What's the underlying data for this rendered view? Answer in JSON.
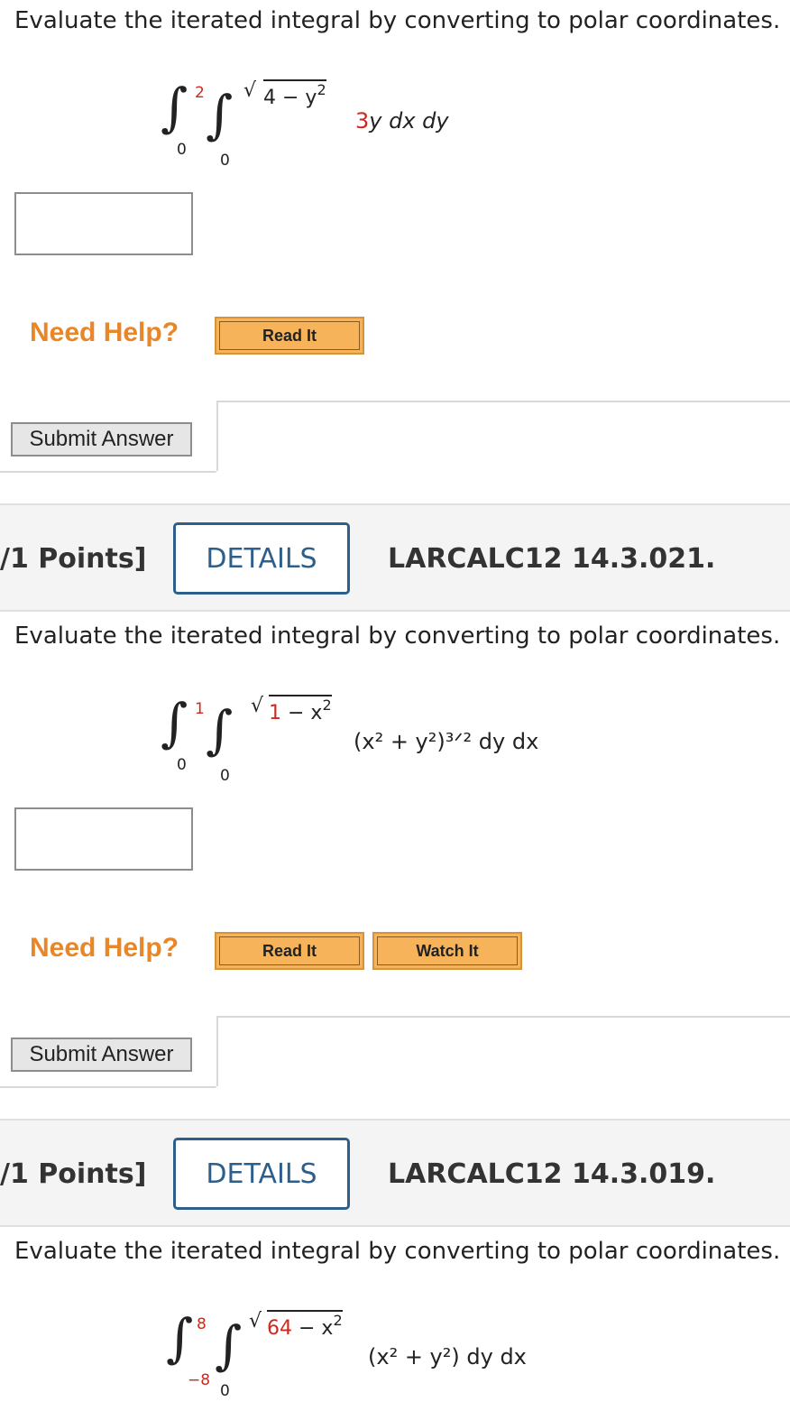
{
  "problem1": {
    "prompt": "Evaluate the iterated integral by converting to polar coordinates.",
    "outer_upper": "2",
    "outer_lower": "0",
    "inner_lower": "0",
    "radicand": "4 − y",
    "radicand_exp": "2",
    "integrand": "3y dx dy",
    "need_help": "Need Help?",
    "read_it": "Read It",
    "submit": "Submit Answer"
  },
  "problem2": {
    "points": "/1 Points]",
    "details": "DETAILS",
    "id": "LARCALC12 14.3.021.",
    "prompt": "Evaluate the iterated integral by converting to polar coordinates.",
    "outer_upper": "1",
    "outer_lower": "0",
    "inner_lower": "0",
    "radicand_num": "1",
    "radicand_rest": " − x",
    "radicand_exp": "2",
    "integrand": "(x² + y²)³ᐟ² dy dx",
    "need_help": "Need Help?",
    "read_it": "Read It",
    "watch_it": "Watch It",
    "submit": "Submit Answer"
  },
  "problem3": {
    "points": "/1 Points]",
    "details": "DETAILS",
    "id": "LARCALC12 14.3.019.",
    "prompt": "Evaluate the iterated integral by converting to polar coordinates.",
    "outer_upper": "8",
    "outer_lower": "−8",
    "inner_lower": "0",
    "radicand_num": "64",
    "radicand_rest": " − x",
    "radicand_exp": "2",
    "integrand": "(x² + y²) dy dx"
  },
  "colors": {
    "accent_red": "#d0281e",
    "help_orange": "#e8862a",
    "details_blue": "#2d5f8a"
  }
}
